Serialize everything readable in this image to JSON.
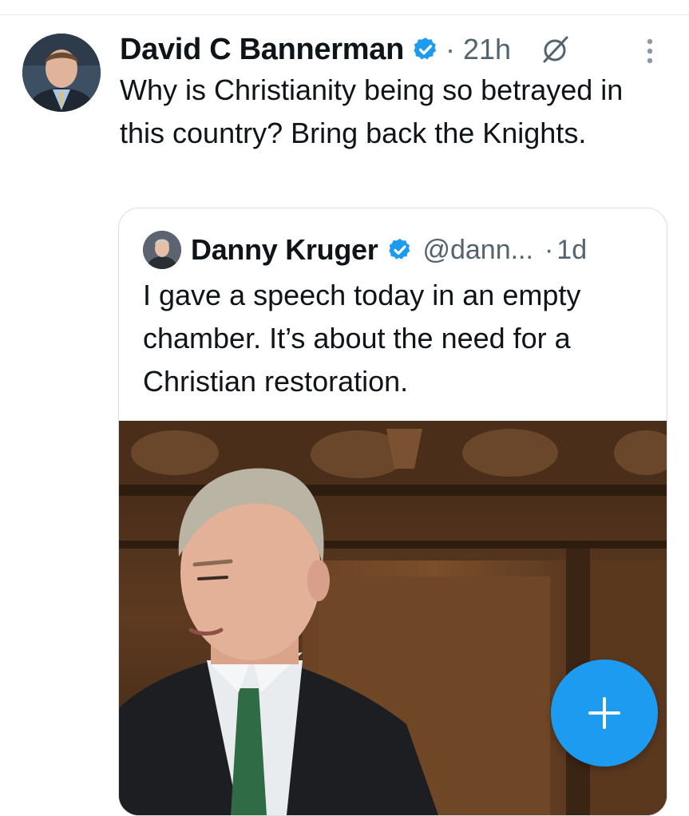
{
  "tweet": {
    "author_name": "David C Bannerman",
    "time": "· 21h",
    "text": "Why is Christianity being so betrayed in this country? Bring back the Knights."
  },
  "quoted_tweet": {
    "author_name": "Danny Kruger",
    "handle": "@dann...",
    "separator": "·",
    "time": "1d",
    "text": "I gave a speech today in an empty chamber. It’s about the need for a Christian restoration."
  },
  "icons": {
    "verified": "verified-badge-icon",
    "grok": "grok-icon",
    "more": "more-vertical-icon",
    "compose": "plus-icon"
  },
  "colors": {
    "accent": "#1d9bf0",
    "text_primary": "#0f1419",
    "text_secondary": "#536471",
    "border": "#d9dee2"
  }
}
